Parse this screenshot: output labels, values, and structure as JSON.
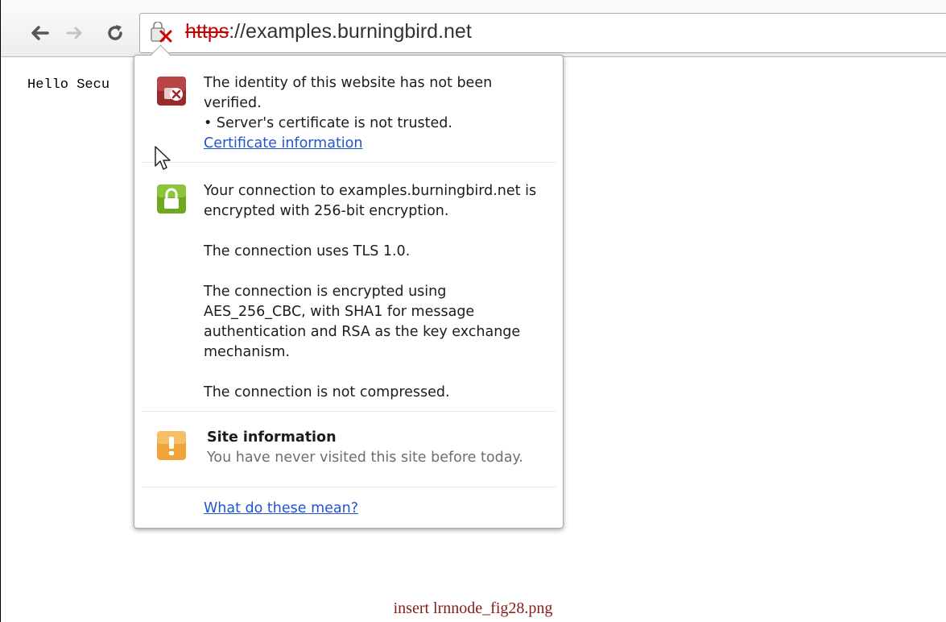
{
  "browser": {
    "back_icon": "back-arrow-icon",
    "forward_icon": "forward-arrow-icon",
    "reload_icon": "reload-icon",
    "url_scheme": "https",
    "url_rest": "://examples.burningbird.net",
    "security_icon": "broken-lock-icon"
  },
  "page": {
    "text": "Hello Secu"
  },
  "bubble": {
    "identity": {
      "line1": "The identity of this website has not been verified.",
      "bullet": "• Server's certificate is not trusted.",
      "link": "Certificate information",
      "icon": "identity-error-icon",
      "color": "#9b2a2a"
    },
    "connection": {
      "p1": "Your connection to examples.burningbird.net is encrypted with 256-bit encryption.",
      "p2": "The connection uses TLS 1.0.",
      "p3": "The connection is encrypted using AES_256_CBC, with SHA1 for message authentication and RSA as the key exchange mechanism.",
      "p4": "The connection is not compressed.",
      "icon": "green-lock-icon",
      "color": "#6fa81e"
    },
    "site": {
      "title": "Site information",
      "text": "You have never visited this site before today.",
      "icon": "warning-icon",
      "color": "#f0a43a"
    },
    "help_link": "What do these mean?"
  },
  "caption": "insert lrnnode_fig28.png",
  "colors": {
    "link": "#2255cc",
    "error": "#c40000",
    "caption": "#8a1a1a"
  }
}
